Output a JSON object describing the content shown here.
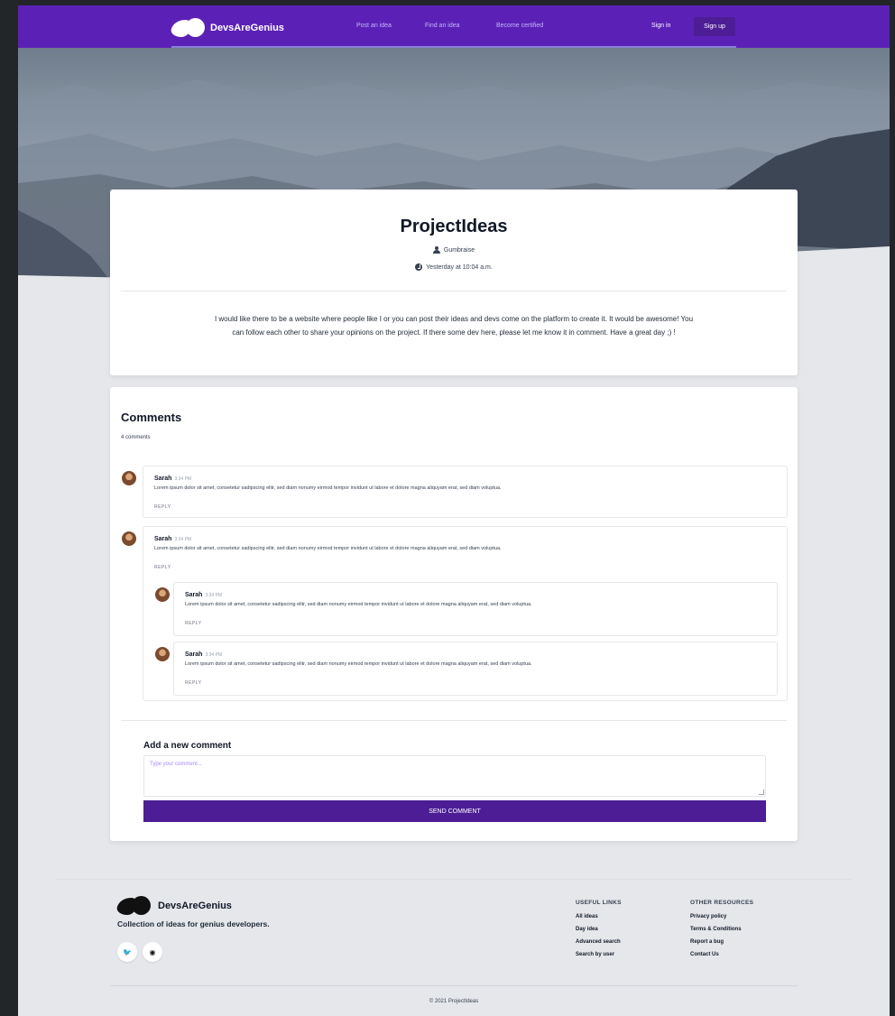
{
  "nav": {
    "brand": "DevsAreGenius",
    "links": [
      "Post an idea",
      "Find an idea",
      "Become certified"
    ],
    "signin": "Sign in",
    "signup": "Sign up"
  },
  "post": {
    "title": "ProjectIdeas",
    "author": "Gumbraise",
    "date": "Yesterday at 10:04 a.m.",
    "body": "I would like there to be a website where people like I or you can post their ideas and devs come on the platform to create it. It would be awesome! You can follow each other to share your opinions on the project. If there some dev here, please let me know it in comment. Have a great day ;) !"
  },
  "comments": {
    "title": "Comments",
    "count": "4 comments",
    "items": [
      {
        "name": "Sarah",
        "time": "3:34 PM",
        "text": "Lorem ipsum dolor sit amet, consetetur sadipscing elitr, sed diam nonumy eirmod tempor invidunt ut labore et dolore magna aliquyam erat, sed diam voluptua.",
        "reply": "REPLY"
      },
      {
        "name": "Sarah",
        "time": "3:34 PM",
        "text": "Lorem ipsum dolor sit amet, consetetur sadipscing elitr, sed diam nonumy eirmod tempor invidunt ut labore et dolore magna aliquyam erat, sed diam voluptua.",
        "reply": "REPLY"
      },
      {
        "name": "Sarah",
        "time": "3:34 PM",
        "text": "Lorem ipsum dolor sit amet, consetetur sadipscing elitr, sed diam nonumy eirmod tempor invidunt ut labore et dolore magna aliquyam erat, sed diam voluptua.",
        "reply": "REPLY"
      },
      {
        "name": "Sarah",
        "time": "3:34 PM",
        "text": "Lorem ipsum dolor sit amet, consetetur sadipscing elitr, sed diam nonumy eirmod tempor invidunt ut labore et dolore magna aliquyam erat, sed diam voluptua.",
        "reply": "REPLY"
      }
    ],
    "add_title": "Add a new comment",
    "placeholder": "Type your comment...",
    "send": "SEND COMMENT"
  },
  "footer": {
    "brand": "DevsAreGenius",
    "tagline": "Collection of ideas for genius developers.",
    "useful_title": "USEFUL LINKS",
    "useful_links": [
      "All ideas",
      "Day idea",
      "Advanced search",
      "Search by user"
    ],
    "other_title": "OTHER RESOURCES",
    "other_links": [
      "Privacy policy",
      "Terms & Conditions",
      "Report a bug",
      "Contact Us"
    ],
    "copyright": "© 2021 ProjectIdeas"
  },
  "colors": {
    "brand_purple": "#5b21b6",
    "button_purple": "#4c1d95",
    "page_bg": "#e5e7eb"
  },
  "icons": [
    "user-icon",
    "clock-icon",
    "twitter-icon",
    "github-icon"
  ]
}
